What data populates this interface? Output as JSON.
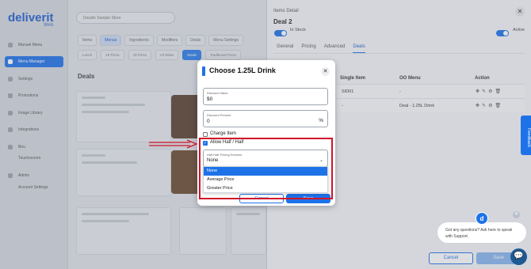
{
  "app": {
    "logo": "deliverit",
    "logo_sub": "Web"
  },
  "sidebar": {
    "items": [
      {
        "label": "Manuel Menu"
      },
      {
        "label": "Menu Manager"
      },
      {
        "label": "Settings"
      },
      {
        "label": "Promotions"
      },
      {
        "label": "Image Library"
      },
      {
        "label": "Integrations"
      },
      {
        "label": "Biru"
      },
      {
        "label": "Touchscreen"
      },
      {
        "label": "Admin"
      },
      {
        "label": "Account Settings"
      }
    ]
  },
  "main": {
    "store_select": "Doodle Sample Store",
    "tabs": [
      "Items",
      "Menus",
      "Ingredients",
      "Modifiers",
      "Deals",
      "Menu Settings"
    ],
    "chips": [
      "Lunch",
      "10 Pizza",
      "All Pizza",
      "All Sides",
      "Deals",
      "Traditional Pizza"
    ],
    "heading": "Deals"
  },
  "panel": {
    "title": "Items Detail",
    "deal_name": "Deal 2",
    "in_stock_label": "In Stock",
    "active_label": "Active",
    "tabs": [
      "General",
      "Pricing",
      "Advanced",
      "Deals"
    ],
    "table": {
      "headers": [
        "Single Item",
        "OO Menu",
        "Action"
      ],
      "rows": [
        {
          "single_item": "SID01",
          "oo_menu": "-"
        },
        {
          "single_item": "-",
          "oo_menu": "Deal - 1.25L Drink"
        }
      ]
    },
    "cancel_label": "Cancel",
    "save_label": "Save"
  },
  "feedback_label": "Feedback",
  "chat": {
    "avatar": "d",
    "message": "Got any questions? Ask here to speak with Support."
  },
  "modal": {
    "title": "Choose 1.25L Drink",
    "discount_value_label": "Discount Value",
    "discount_value": "$0",
    "discount_percent_label": "Discount Percent",
    "discount_percent": "0",
    "percent_symbol": "%",
    "charge_item_label": "Charge Item",
    "allow_half_label": "Allow Half / Half",
    "scheme_label": "Half Half Pricing Scheme",
    "scheme_value": "None",
    "scheme_options": [
      "None",
      "Average Price",
      "Greater Price"
    ],
    "cancel_label": "Cancel",
    "save_label": "Save"
  },
  "colors": {
    "accent": "#1e72e8",
    "highlight": "#d0142a"
  }
}
